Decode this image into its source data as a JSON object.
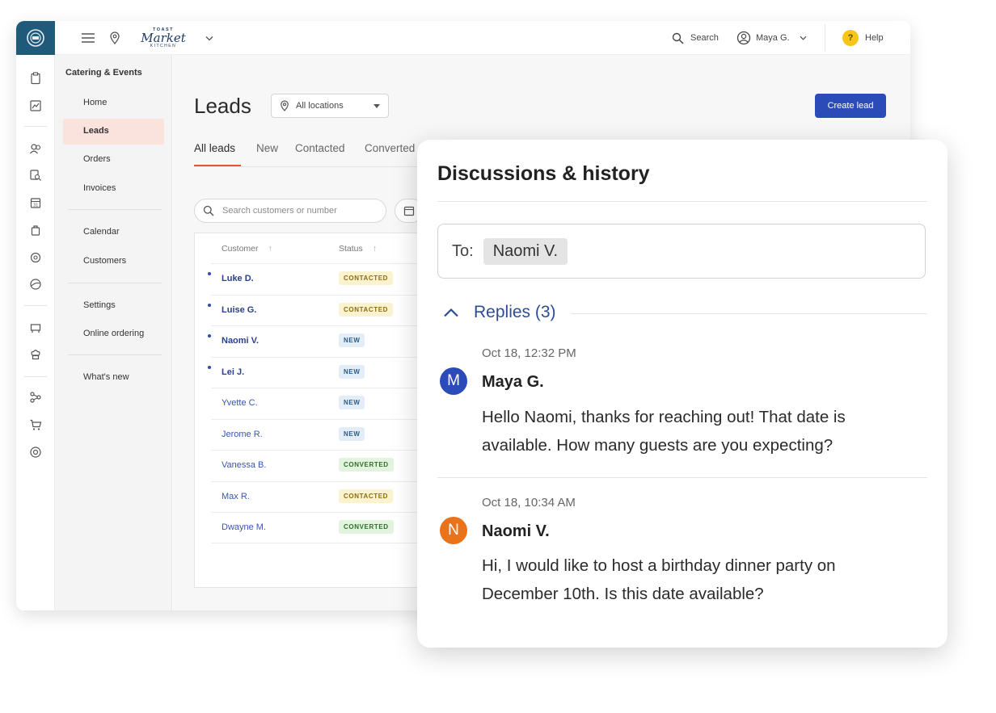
{
  "topbar": {
    "brand": "Market",
    "brand_top": "TOAST",
    "brand_sub": "KITCHEN",
    "search_label": "Search",
    "user_name": "Maya G.",
    "help_label": "Help",
    "help_glyph": "?"
  },
  "nav": {
    "section_title": "Catering & Events",
    "items": [
      {
        "label": "Home"
      },
      {
        "label": "Leads"
      },
      {
        "label": "Orders"
      },
      {
        "label": "Invoices"
      },
      {
        "label": "Calendar"
      },
      {
        "label": "Customers"
      },
      {
        "label": "Settings"
      },
      {
        "label": "Online ordering"
      },
      {
        "label": "What's new"
      }
    ]
  },
  "main": {
    "title": "Leads",
    "location_select": "All locations",
    "create_button": "Create lead",
    "tabs": [
      {
        "label": "All leads"
      },
      {
        "label": "New"
      },
      {
        "label": "Contacted"
      },
      {
        "label": "Converted"
      }
    ],
    "search_placeholder": "Search customers or number",
    "table": {
      "headers": {
        "customer": "Customer",
        "status": "Status"
      },
      "rows": [
        {
          "customer": "Luke D.",
          "status": "CONTACTED"
        },
        {
          "customer": "Luise G.",
          "status": "CONTACTED"
        },
        {
          "customer": "Naomi V.",
          "status": "NEW"
        },
        {
          "customer": "Lei J.",
          "status": "NEW"
        },
        {
          "customer": "Yvette C.",
          "status": "NEW"
        },
        {
          "customer": "Jerome R.",
          "status": "NEW"
        },
        {
          "customer": "Vanessa B.",
          "status": "CONVERTED"
        },
        {
          "customer": "Max R.",
          "status": "CONTACTED"
        },
        {
          "customer": "Dwayne M.",
          "status": "CONVERTED"
        }
      ]
    }
  },
  "panel": {
    "title": "Discussions & history",
    "to_label": "To:",
    "recipient": "Naomi V.",
    "replies_label": "Replies (3)",
    "messages": [
      {
        "time": "Oct 18, 12:32 PM",
        "initial": "M",
        "author": "Maya G.",
        "line1": "Hello Naomi, thanks for reaching out! That date is",
        "line2": "available. How many guests are you expecting?"
      },
      {
        "time": "Oct 18, 10:34 AM",
        "initial": "N",
        "author": "Naomi V.",
        "line1": "Hi, I would like to host a birthday dinner party on",
        "line2": "December 10th. Is this date available?"
      }
    ]
  },
  "colors": {
    "primary": "#2a4bb8",
    "accent_orange": "#e4572e",
    "rail_logo_bg": "#1f5a7a",
    "avatar_maya": "#2a4bb8",
    "avatar_naomi": "#e8731a",
    "nav_active_bg": "#fbe3dd"
  },
  "icons": {
    "rail": [
      "clipboard-icon",
      "chart-icon",
      "guests-icon",
      "search-doc-icon",
      "calendar-icon",
      "bag-icon",
      "settings-icon",
      "globe-icon",
      "table-icon",
      "chef-hat-icon",
      "share-icon",
      "cart-icon",
      "target-icon"
    ]
  }
}
